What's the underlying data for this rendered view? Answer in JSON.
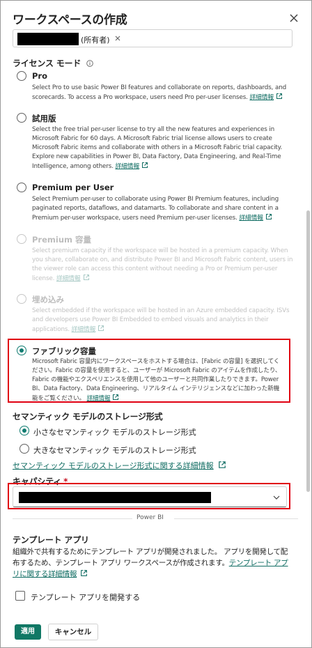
{
  "dialog": {
    "title": "ワークスペースの作成",
    "owner_tag": "(所有者)"
  },
  "license": {
    "section_title": "ライセンス モード",
    "options": [
      {
        "title": "Pro",
        "description": "Select Pro to use basic Power BI features and collaborate on reports, dashboards, and scorecards. To access a Pro workspace, users need Pro per-user licenses.",
        "link": "詳細情報",
        "disabled": false,
        "checked": false
      },
      {
        "title": "試用版",
        "description": "Select the free trial per-user license to try all the new features and experiences in Microsoft Fabric for 60 days. A Microsoft Fabric trial license allows users to create Microsoft Fabric items and collaborate with others in a Microsoft Fabric trial capacity. Explore new capabilities in Power BI, Data Factory, Data Engineering, and Real-Time Intelligence, among others.",
        "link": "詳細情報",
        "disabled": false,
        "checked": false
      },
      {
        "title": "Premium per User",
        "description": "Select Premium per-user to collaborate using Power BI Premium features, including paginated reports, dataflows, and datamarts. To collaborate and share content in a Premium per-user workspace, users need Premium per-user licenses.",
        "link": "詳細情報",
        "disabled": false,
        "checked": false
      },
      {
        "title": "Premium 容量",
        "description": "Select premium capacity if the workspace will be hosted in a premium capacity. When you share, collaborate on, and distribute Power BI and Microsoft Fabric content, users in the viewer role can access this content without needing a Pro or Premium per-user license.",
        "link": "詳細情報",
        "disabled": true,
        "checked": false
      },
      {
        "title": "埋め込み",
        "description": "Select embedded if the workspace will be hosted in an Azure embedded capacity. ISVs and developers use Power BI Embedded to embed visuals and analytics in their applications.",
        "link": "詳細情報",
        "disabled": true,
        "checked": false
      },
      {
        "title": "ファブリック容量",
        "description": "Microsoft Fabric 容量内にワークスペースをホストする場合は、[Fabric の容量] を選択してください。Fabric の容量を使用すると、ユーザーが Microsoft Fabric のアイテムを作成したり、Fabric の機能やエクスペリエンスを使用して他のユーザーと共同作業したりできます。Power BI、Data Factory、Data Engineering、リアルタイム インテリジェンスなどに加わった新機能をご覧ください。",
        "link": "詳細情報",
        "disabled": false,
        "checked": true
      }
    ]
  },
  "storage": {
    "section_title": "セマンティック モデルのストレージ形式",
    "small_label": "小さなセマンティック モデルのストレージ形式",
    "large_label": "大きなセマンティック モデルのストレージ形式",
    "details_link": "セマンティック モデルのストレージ形式に関する詳細情報"
  },
  "capacity": {
    "label": "キャパシティ",
    "required_mark": "*"
  },
  "divider_text": "Power BI",
  "template_app": {
    "title": "テンプレート アプリ",
    "description": "組織外で共有するためにテンプレート アプリが開発されました。 アプリを開発して配布するため、テンプレート アプリ ワークスペースが作成されます。",
    "link": "テンプレート アプリに関する詳細情報",
    "checkbox_label": "テンプレート アプリを開発する"
  },
  "buttons": {
    "apply": "適用",
    "cancel": "キャンセル"
  },
  "colors": {
    "accent": "#117865",
    "link": "#0f6c62",
    "highlight": "#e00012"
  }
}
